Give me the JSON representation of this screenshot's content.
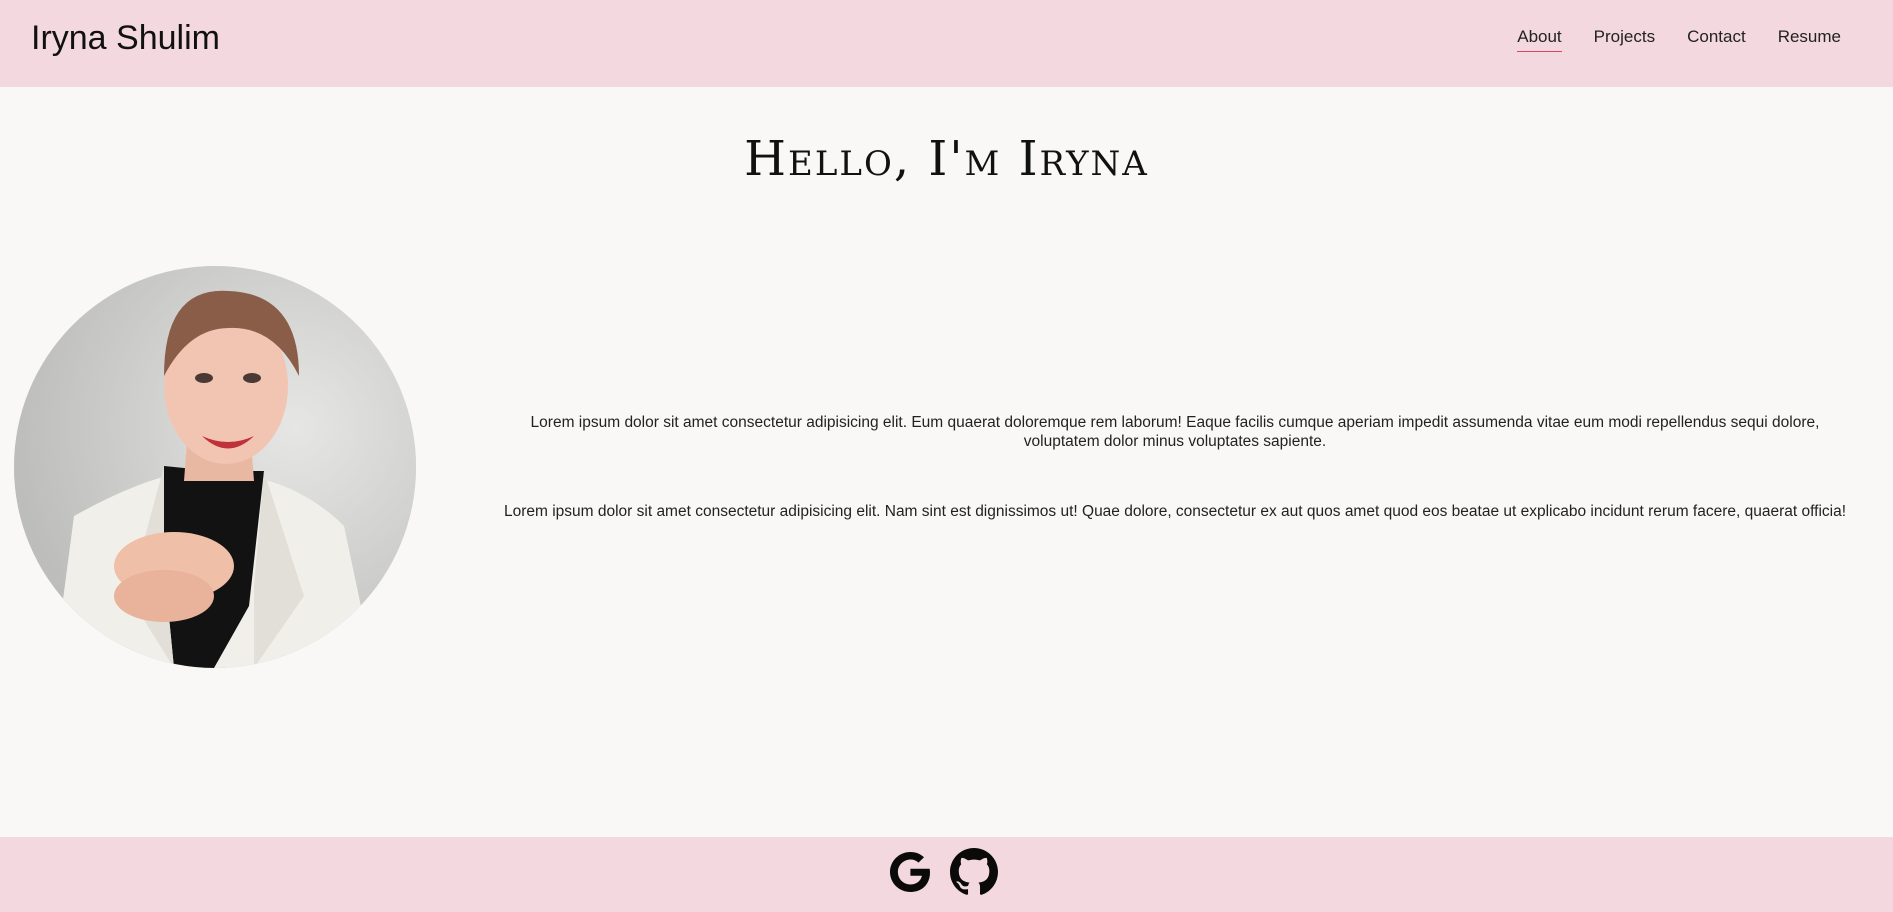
{
  "header": {
    "brand": "Iryna Shulim",
    "nav": [
      {
        "label": "About",
        "active": true
      },
      {
        "label": "Projects"
      },
      {
        "label": "Contact"
      },
      {
        "label": "Resume"
      }
    ]
  },
  "hero": {
    "title": "Hello, I'm Iryna"
  },
  "about": {
    "paragraphs": [
      "Lorem ipsum dolor sit amet consectetur adipisicing elit. Eum quaerat doloremque rem laborum! Eaque facilis cumque aperiam impedit assumenda vitae eum modi repellendus sequi dolore, voluptatem dolor minus voluptates sapiente.",
      "Lorem ipsum dolor sit amet consectetur adipisicing elit. Nam sint est dignissimos ut! Quae dolore, consectetur ex aut quos amet quod eos beatae ut explicabo incidunt rerum facere, quaerat officia!"
    ]
  },
  "footer": {
    "icons": [
      "google-icon",
      "github-icon"
    ]
  },
  "colors": {
    "header_bg": "#f3d8df",
    "page_bg": "#f9f8f6",
    "nav_active_underline": "#d9475d"
  }
}
